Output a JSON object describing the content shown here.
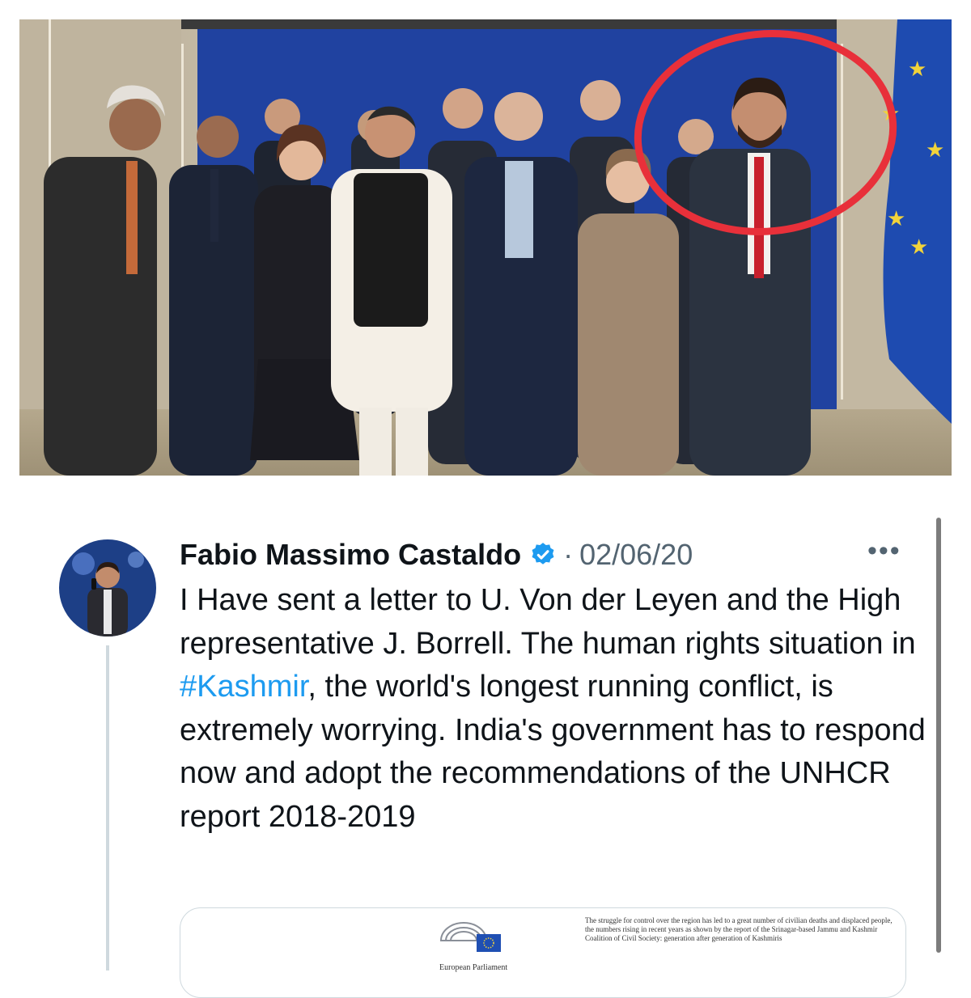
{
  "photo": {
    "flag_color": "#1e4bb0",
    "backdrop_color": "#2042a0",
    "highlight_circle_color": "#e8303a"
  },
  "tweet": {
    "author": "Fabio Massimo Castaldo",
    "verified_icon": "verified-badge-icon",
    "separator": "·",
    "date": "02/06/20",
    "more_label": "•••",
    "text_parts": {
      "part1": "I Have sent a letter to U. Von der Leyen and the High representative J. Borrell. The human rights situation in ",
      "hashtag": "#Kashmir",
      "part2": ", the world's longest running conflict, is extremely worrying. India's government has to respond now and adopt the recommendations of the UNHCR report 2018-2019"
    },
    "accent_color": "#1d9bf0"
  },
  "card": {
    "logo_caption": "European Parliament",
    "doc_excerpt": "The struggle for control over the region has led to a great number of civilian deaths and displaced people, the numbers rising in recent years as shown by the report of the Srinagar-based Jammu and Kashmir Coalition of Civil Society: generation after generation of Kashmiris"
  }
}
